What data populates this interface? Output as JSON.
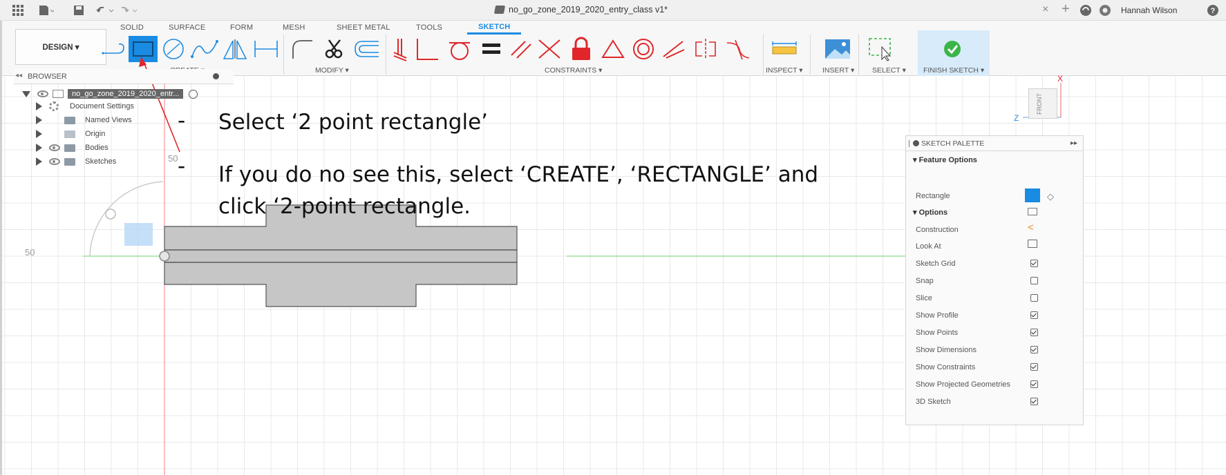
{
  "titlebar": {
    "document_title": "no_go_zone_2019_2020_entry_class v1*",
    "user_name": "Hannah Wilson"
  },
  "ribbon": {
    "workspace_button": "DESIGN ▾",
    "tabs": [
      "SOLID",
      "SURFACE",
      "FORM",
      "MESH",
      "SHEET METAL",
      "TOOLS",
      "SKETCH"
    ],
    "active_tab": "SKETCH",
    "groups": {
      "create": "CREATE ▾",
      "modify": "MODIFY ▾",
      "constraints": "CONSTRAINTS ▾",
      "inspect": "INSPECT ▾",
      "insert": "INSERT ▾",
      "select": "SELECT ▾",
      "finish": "FINISH SKETCH ▾"
    }
  },
  "browser": {
    "header": "BROWSER",
    "root": "no_go_zone_2019_2020_entr...",
    "items": [
      {
        "label": "Document Settings"
      },
      {
        "label": "Named Views"
      },
      {
        "label": "Origin"
      },
      {
        "label": "Bodies"
      },
      {
        "label": "Sketches"
      }
    ]
  },
  "canvas": {
    "axis_label_top": "50",
    "axis_label_left": "50",
    "triad_x": "X",
    "triad_z": "Z",
    "viewcube_face": "FRONT"
  },
  "annotation": {
    "line1": "Select ‘2 point rectangle’",
    "line2": "If you do no see this, select ‘CREATE’, ‘RECTANGLE’ and",
    "line3": "click ‘2-point rectangle.",
    "dash": "-"
  },
  "palette": {
    "header": "SKETCH PALETTE",
    "feature_options": "▾ Feature Options",
    "rectangle_label": "Rectangle",
    "options": "▾ Options",
    "rows": [
      {
        "label": "Construction",
        "state": "icon"
      },
      {
        "label": "Look At",
        "state": "icon"
      },
      {
        "label": "Sketch Grid",
        "checked": true
      },
      {
        "label": "Snap",
        "checked": false
      },
      {
        "label": "Slice",
        "checked": false
      },
      {
        "label": "Show Profile",
        "checked": true
      },
      {
        "label": "Show Points",
        "checked": true
      },
      {
        "label": "Show Dimensions",
        "checked": true
      },
      {
        "label": "Show Constraints",
        "checked": true
      },
      {
        "label": "Show Projected Geometries",
        "checked": true
      },
      {
        "label": "3D Sketch",
        "checked": true
      }
    ]
  },
  "colors": {
    "accent": "#1a8be3",
    "annotation_arrow": "#e0262a",
    "constraint_red": "#e0262a",
    "finish_green": "#3bb44a",
    "sketch_fill": "#c8c8c8"
  }
}
